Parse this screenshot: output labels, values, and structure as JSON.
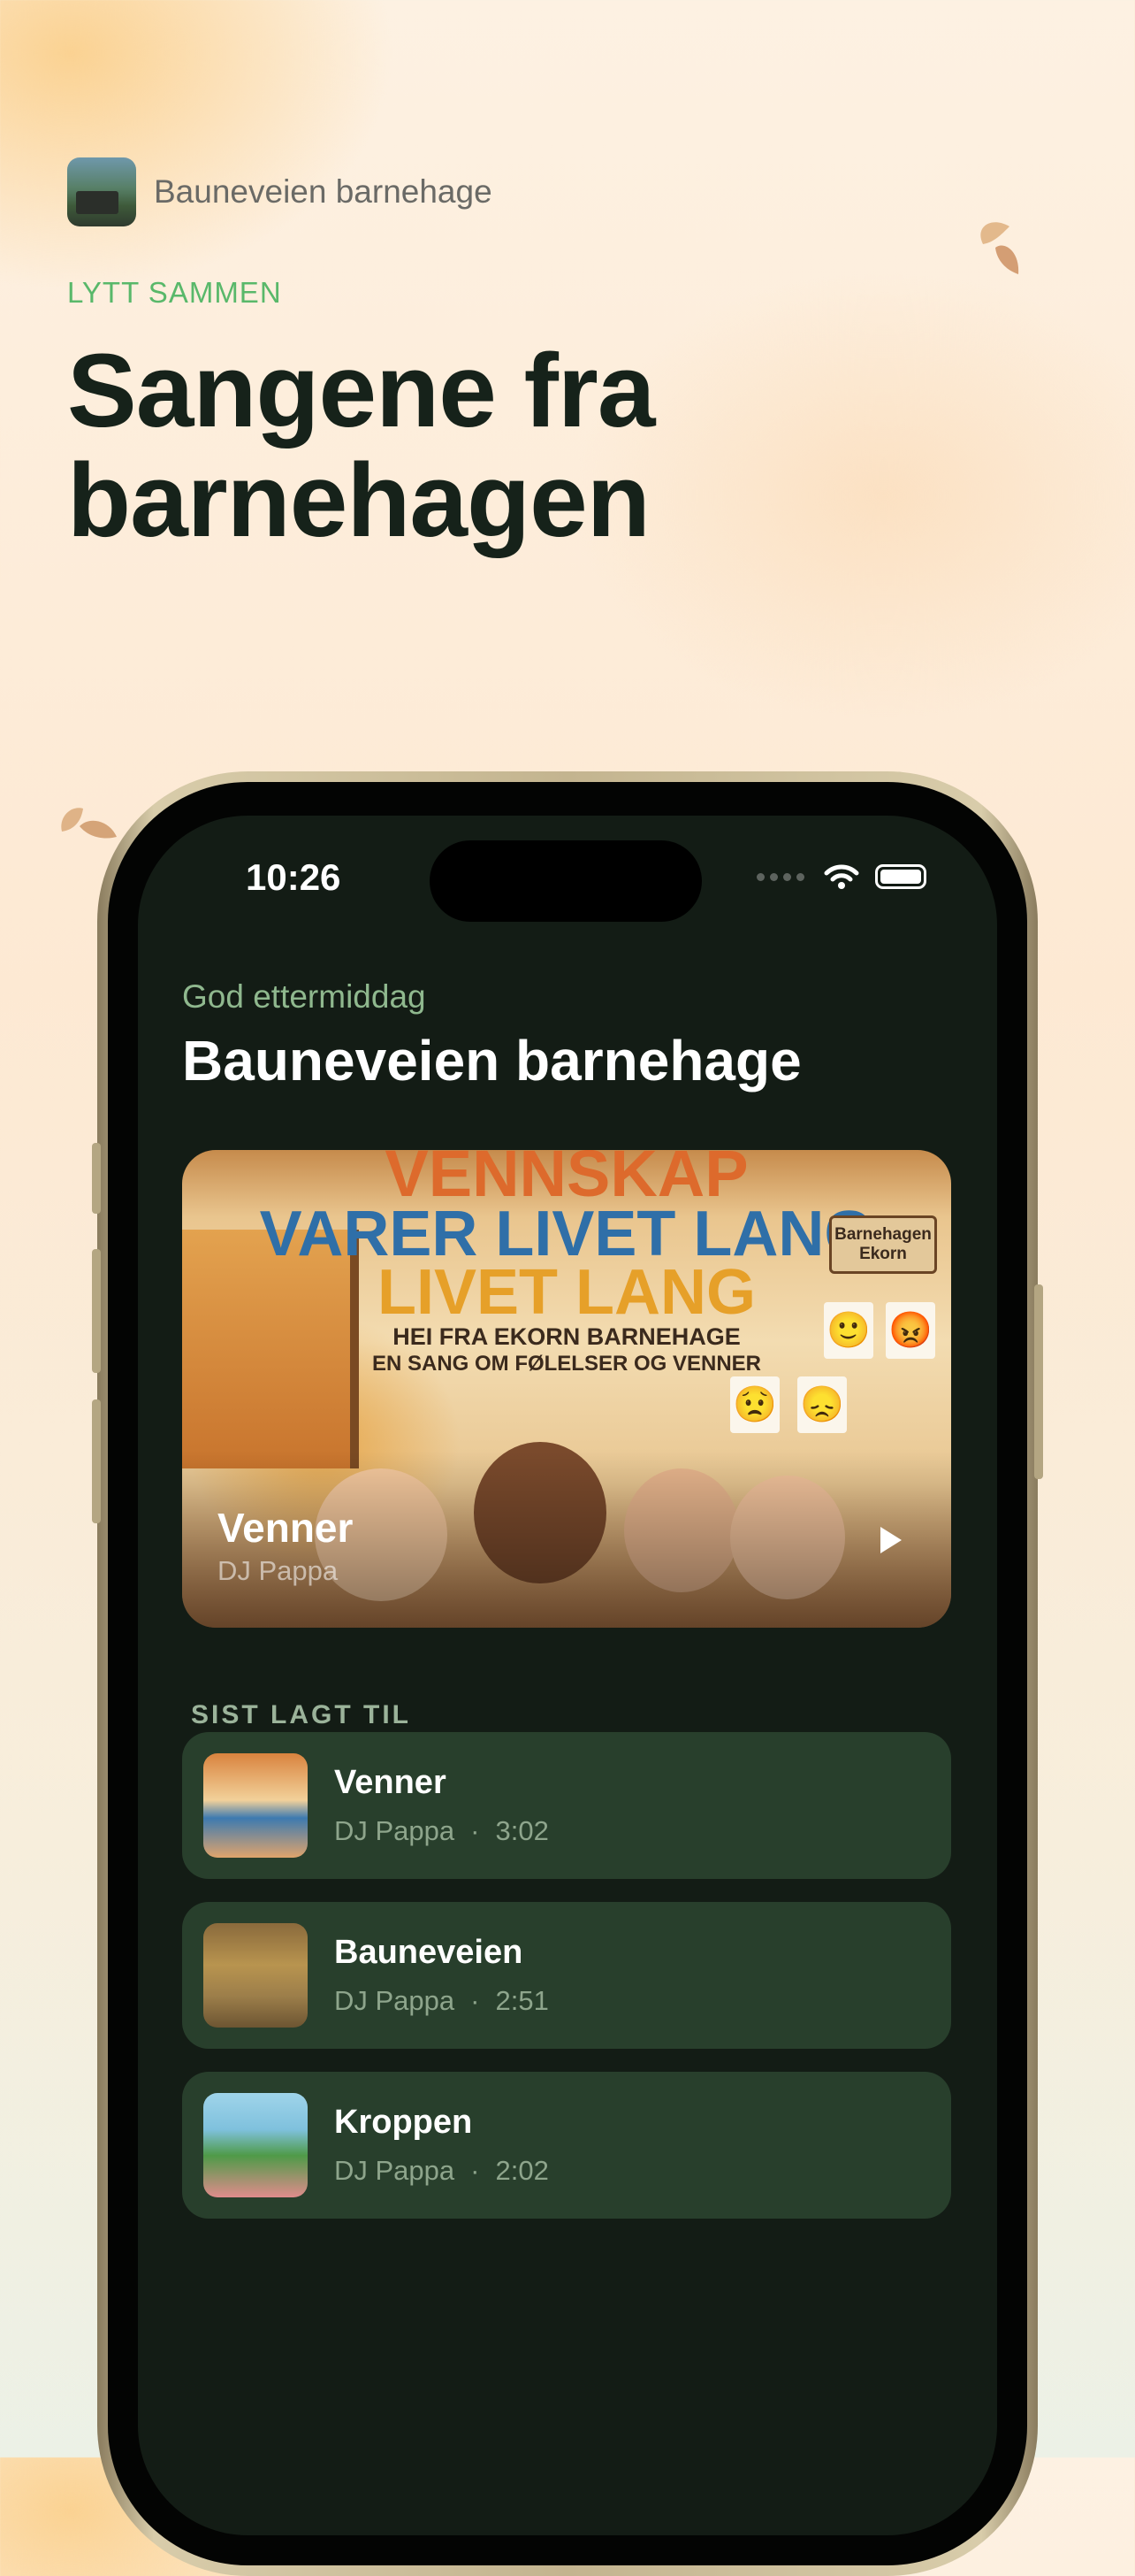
{
  "brand": {
    "name": "Bauneveien barnehage"
  },
  "eyebrow": "LYTT SAMMEN",
  "headline": {
    "line1": "Sangene fra",
    "line2": "barnehagen"
  },
  "phone": {
    "status": {
      "time": "10:26"
    },
    "greeting": "God ettermiddag",
    "title": "Bauneveien barnehage",
    "featured": {
      "art": {
        "line1": "VENNSKAP",
        "line2": "VARER LIVET LANG",
        "line3": "LIVET LANG",
        "line4": "HEI FRA EKORN BARNEHAGE",
        "line5": "EN SANG OM FØLELSER OG VENNER",
        "sign": "Barnehagen Ekorn"
      },
      "title": "Venner",
      "artist": "DJ Pappa"
    },
    "section_label": "SIST LAGT TIL",
    "tracks": [
      {
        "title": "Venner",
        "artist": "DJ Pappa",
        "duration": "3:02"
      },
      {
        "title": "Bauneveien",
        "artist": "DJ Pappa",
        "duration": "2:51"
      },
      {
        "title": "Kroppen",
        "artist": "DJ Pappa",
        "duration": "2:02"
      }
    ]
  },
  "colors": {
    "accent_green": "#59b86a",
    "screen_bg": "#131c15",
    "card_bg": "#283f2c",
    "headline": "#16221a"
  },
  "icons": [
    "leaf-icon",
    "wifi-icon",
    "battery-icon",
    "play-icon"
  ]
}
